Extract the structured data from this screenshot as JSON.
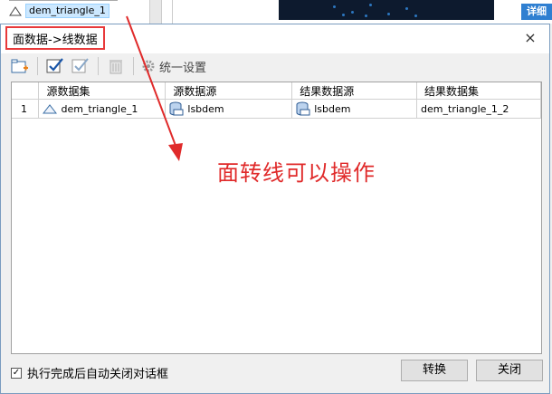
{
  "background": {
    "tree_selected_item": "dem_triangle_1",
    "detail_button": "详细"
  },
  "dialog": {
    "title": "面数据->线数据",
    "close_glyph": "×",
    "toolbar": {
      "unify_settings_label": "统一设置"
    },
    "grid": {
      "columns": [
        "",
        "源数据集",
        "源数据源",
        "结果数据源",
        "结果数据集"
      ],
      "rows": [
        {
          "index": "1",
          "source_dataset": "dem_triangle_1",
          "source_datasource": "lsbdem",
          "result_datasource": "lsbdem",
          "result_dataset": "dem_triangle_1_2"
        }
      ]
    },
    "annotation": "面转线可以操作",
    "footer": {
      "auto_close_label": "执行完成后自动关闭对话框",
      "auto_close_checked": true,
      "convert_button": "转换",
      "close_button": "关闭"
    }
  },
  "colors": {
    "annotation_red": "#e02a2a",
    "highlight_box": "#e8393a",
    "selection_bg": "#cce8ff",
    "detail_blue": "#2f7fd1"
  }
}
